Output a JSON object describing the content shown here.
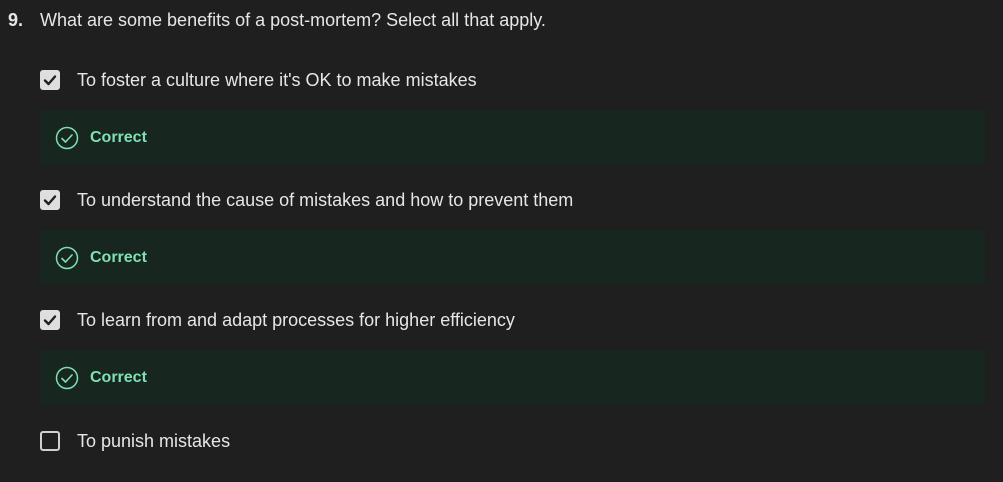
{
  "question": {
    "number": "9.",
    "text": "What are some benefits of a post-mortem? Select all that apply."
  },
  "options": [
    {
      "label": "To foster a culture where it's OK to make mistakes",
      "checked": true,
      "feedback": "Correct"
    },
    {
      "label": "To understand the cause of mistakes and how to prevent them",
      "checked": true,
      "feedback": "Correct"
    },
    {
      "label": "To learn from and adapt processes for higher efficiency",
      "checked": true,
      "feedback": "Correct"
    },
    {
      "label": "To punish mistakes",
      "checked": false,
      "feedback": ""
    }
  ],
  "colors": {
    "background": "#1f1f1f",
    "feedback_background": "#17261f",
    "correct_green": "#7fe0b2",
    "checkbox_fill": "#dedede"
  },
  "icons": {
    "checked": "checkmark-icon",
    "feedback": "check-circle-icon"
  }
}
